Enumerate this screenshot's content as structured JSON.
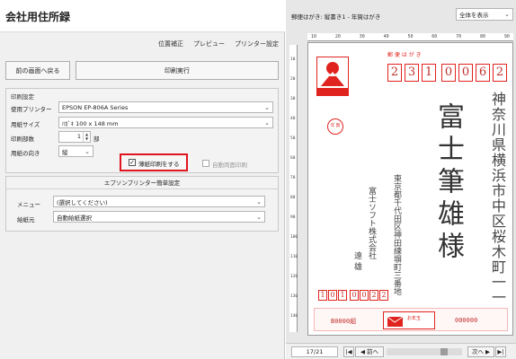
{
  "app": {
    "title": "会社用住所録"
  },
  "toolbar": {
    "links": [
      "位置補正",
      "プレビュー",
      "プリンター設定"
    ]
  },
  "buttons": {
    "back": "前の画面へ戻る",
    "print": "印刷実行"
  },
  "print_settings": {
    "title": "印刷設定",
    "printer_label": "使用プリンター",
    "printer_value": "EPSON EP-806A Series",
    "paper_label": "用紙サイズ",
    "paper_value": "ﾊｶﾞｷ 100 x 148 mm",
    "copies_label": "印刷部数",
    "copies_value": "1",
    "copies_unit": "部",
    "orientation_label": "用紙の向き",
    "orientation_value": "縦",
    "thin_paper": {
      "label": "薄紙印刷をする",
      "checked": true
    },
    "duplex": {
      "label": "自動両面印刷",
      "checked": false
    }
  },
  "epson": {
    "title": "エプソンプリンター簡単設定",
    "menu_label": "メニュー",
    "menu_value": "(選択してください)",
    "feed_label": "給紙元",
    "feed_value": "自動給紙選択"
  },
  "preview": {
    "title": "郵便はがき: 縦書き1 - 年賀はがき",
    "zoom": "全体を表示",
    "ruler_ticks": [
      "10",
      "20",
      "30",
      "40",
      "50",
      "60",
      "70",
      "80",
      "90"
    ],
    "ruler_left_ticks": [
      "10",
      "20",
      "30",
      "40",
      "50",
      "60",
      "70",
      "80",
      "90",
      "100",
      "110",
      "120",
      "130",
      "140"
    ]
  },
  "card": {
    "header": "郵 便 は が き",
    "postal_code": [
      "2",
      "3",
      "1",
      "0",
      "0",
      "6",
      "2"
    ],
    "recipient_address": [
      "神奈川県横浜市中区桜木町一一"
    ],
    "recipient_name": "富士筆雄様",
    "sender_address": "東京都千代田区神田練塀町三番地",
    "sender_company": "富士ソフト株式会社",
    "sender_name": "遠 雄",
    "sender_postal": [
      "1",
      "0",
      "1",
      "0",
      "0",
      "2",
      "2"
    ],
    "stamp_label": "年 賀",
    "lottery_left": "B0000組",
    "lottery_right": "000000",
    "lottery_badge": "お年玉",
    "colors": {
      "accent": "#e0231e"
    }
  },
  "nav": {
    "page": "17/21",
    "prev": "前へ",
    "next": "次へ"
  }
}
